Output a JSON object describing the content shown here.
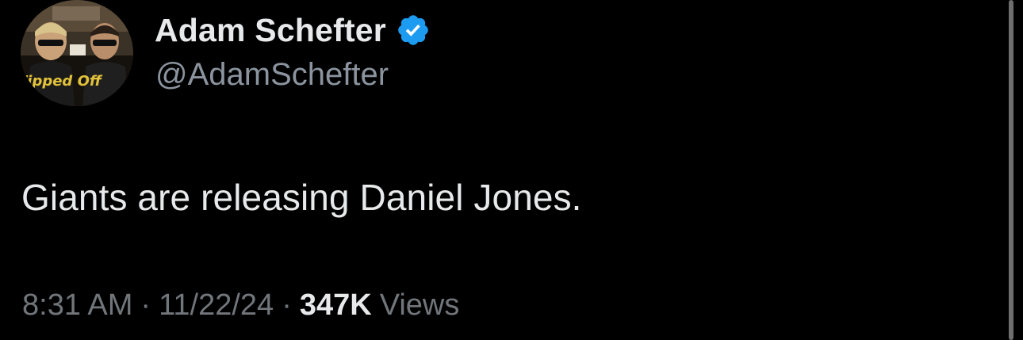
{
  "author": {
    "display_name": "Adam Schefter",
    "handle": "@AdamSchefter",
    "verified": true,
    "verified_color": "#1d9bf0",
    "avatar_text": "Tipped Off",
    "avatar_icon": "profile-avatar"
  },
  "tweet": {
    "text": "Giants are releasing Daniel Jones."
  },
  "meta": {
    "time": "8:31 AM",
    "separator": "·",
    "date": "11/22/24",
    "views_count": "347K",
    "views_label": "Views"
  },
  "colors": {
    "background": "#000000",
    "primary_text": "#e7e9ea",
    "secondary_text": "#71767b"
  }
}
